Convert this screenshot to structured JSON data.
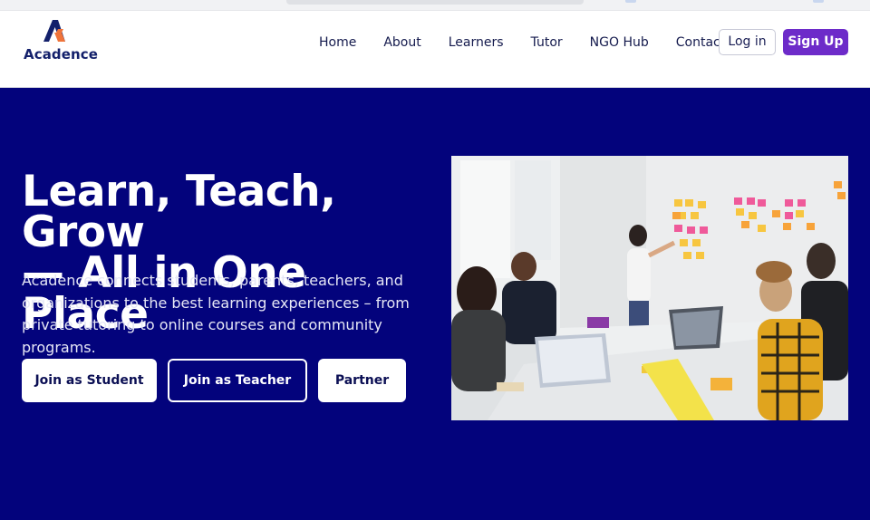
{
  "brand": {
    "name": "Acadence",
    "colors": {
      "navy": "#03037c",
      "purple": "#6d2bc9",
      "logo_orange": "#f0743a",
      "logo_navy": "#13206b"
    }
  },
  "nav": {
    "items": [
      {
        "id": "home",
        "label": "Home"
      },
      {
        "id": "about",
        "label": "About"
      },
      {
        "id": "learners",
        "label": "Learners"
      },
      {
        "id": "tutor",
        "label": "Tutor"
      },
      {
        "id": "ngo-hub",
        "label": "NGO Hub"
      },
      {
        "id": "contact",
        "label": "Contact"
      }
    ],
    "login_label": "Log in",
    "signup_label": "Sign Up"
  },
  "hero": {
    "title_line1": "Learn, Teach, Grow",
    "title_line2": "— All in One Place",
    "subtitle": "Acadence connects students, parents, teachers, and organizations to the best learning experiences – from private tutoring to online courses and community programs.",
    "buttons": {
      "student": "Join as Student",
      "teacher": "Join as Teacher",
      "partner": "Partner"
    },
    "image_icon": "team-meeting-photo"
  }
}
